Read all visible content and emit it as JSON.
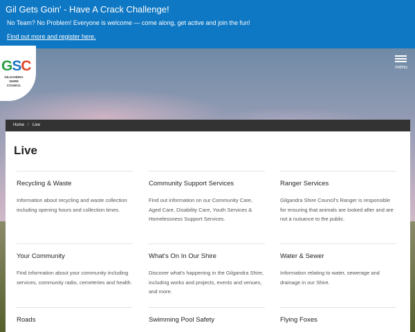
{
  "banner": {
    "title": "Gil Gets Goin' - Have A Crack Challenge!",
    "text": "No Team? No Problem! Everyone is welcome — come along, get active and join the fun!",
    "link": "Find out more and register here."
  },
  "logo": {
    "letters": {
      "g": "G",
      "s": "S",
      "c": "C"
    },
    "subtitle_line1": "GILGANDRA",
    "subtitle_line2": "SHIRE COUNCIL"
  },
  "menu": {
    "label": "menu"
  },
  "breadcrumb": {
    "home": "Home",
    "separator": "/",
    "current": "Live"
  },
  "page": {
    "title": "Live"
  },
  "tiles": [
    {
      "title": "Recycling & Waste",
      "desc": "Information about recycling and waste collection including opening hours and collection times."
    },
    {
      "title": "Community Support Services",
      "desc": "Find out information on our Community Care, Aged Care, Disability Care, Youth Services & Homelessness Support Services."
    },
    {
      "title": "Ranger Services",
      "desc": "Gilgandra Shire Council's Ranger is responsible for ensuring that animals are looked after and are not a nuisance to the public."
    },
    {
      "title": "Your Community",
      "desc": "Find information about your community including services, community radio, cemeteries and health."
    },
    {
      "title": "What's On In Our Shire",
      "desc": "Discover what's happening in the Gilgandra Shire, including works and projects, events and venues, and more."
    },
    {
      "title": "Water & Sewer",
      "desc": "Information relating to water, sewerage and drainage in our Shire."
    },
    {
      "title": "Roads",
      "desc": ""
    },
    {
      "title": "Swimming Pool Safety",
      "desc": ""
    },
    {
      "title": "Flying Foxes",
      "desc": ""
    }
  ],
  "colors": {
    "banner": "#0f78c4",
    "breadcrumb_bar": "#333333",
    "logo_g": "#2a9d45",
    "logo_s": "#1d74c4",
    "logo_c": "#e0452c"
  }
}
